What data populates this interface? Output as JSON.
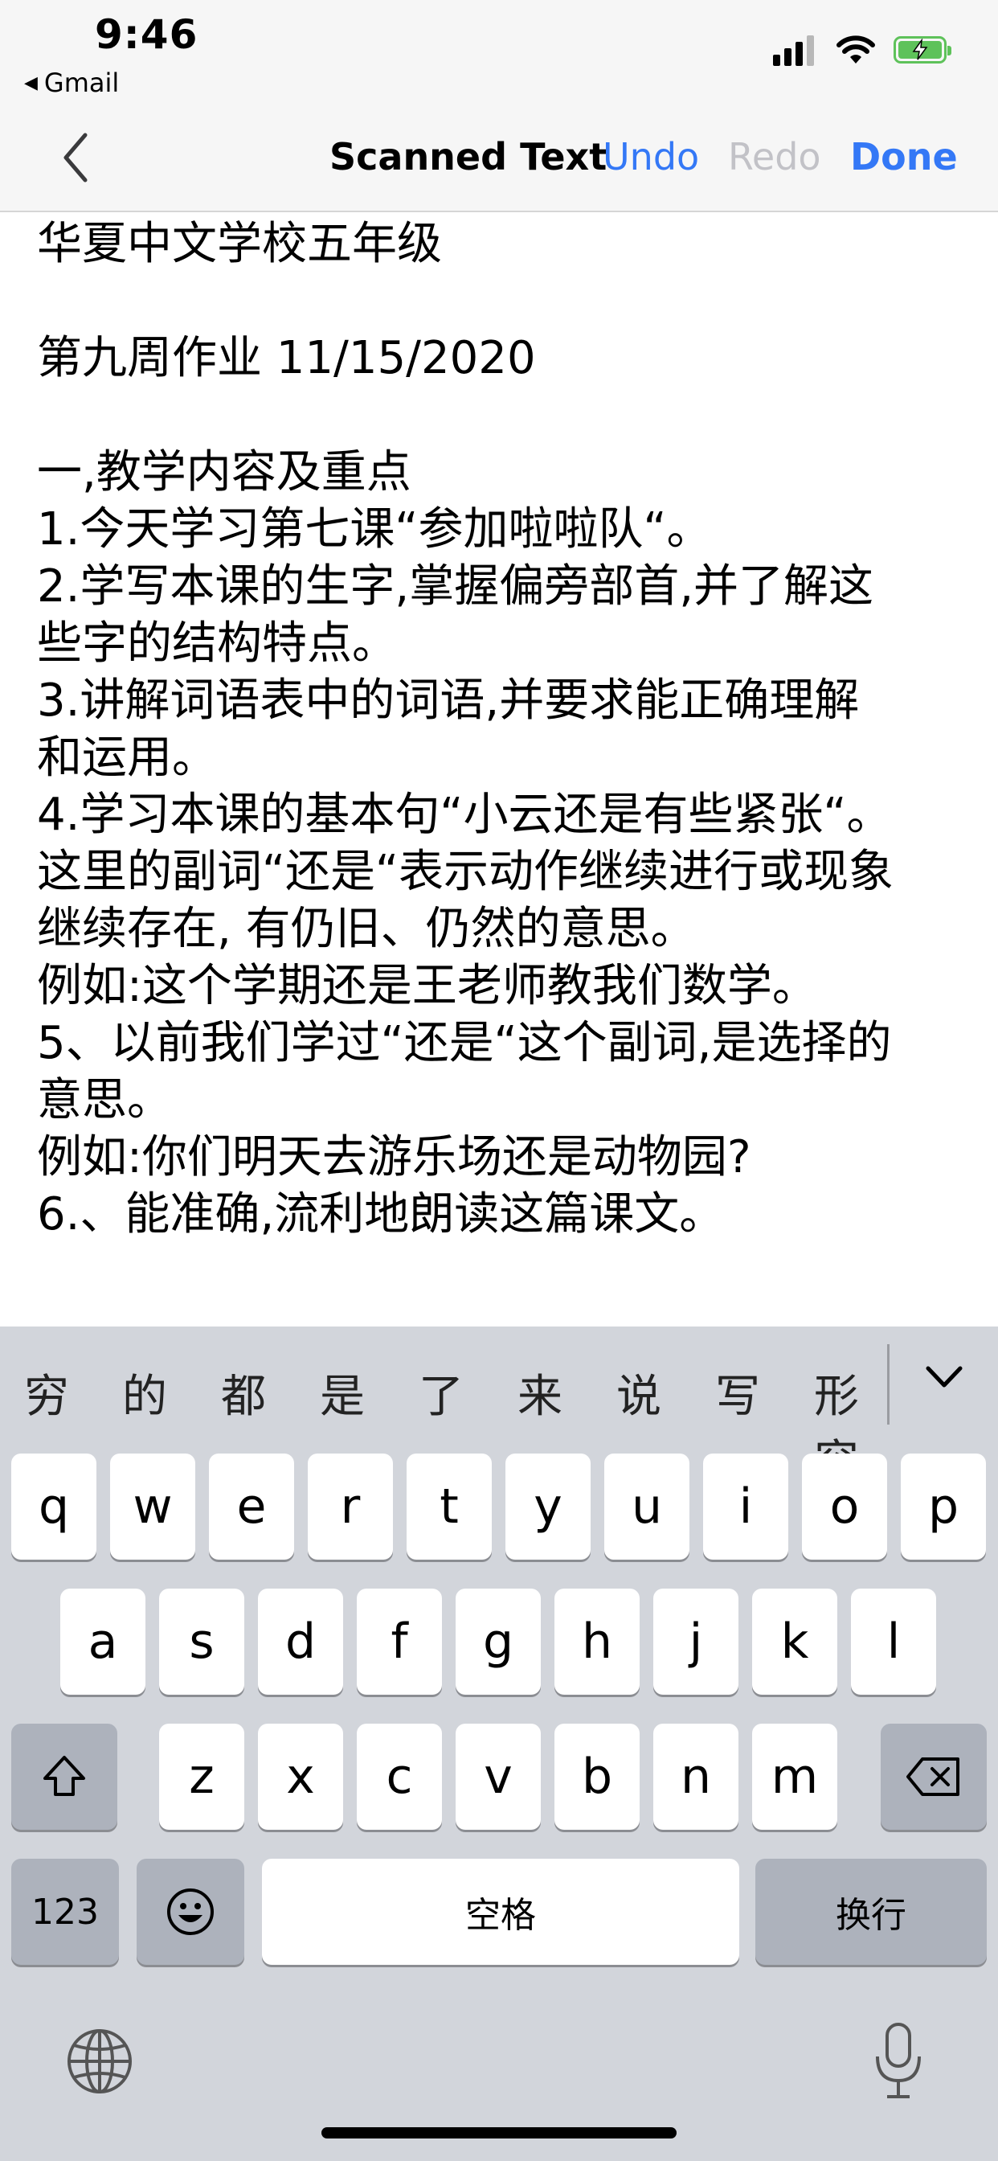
{
  "status_bar": {
    "time": "9:46",
    "back_app": "Gmail",
    "icons": [
      "cellular-signal-icon",
      "wifi-icon",
      "battery-charging-icon"
    ],
    "battery_color": "#5ec25a"
  },
  "nav": {
    "title": "Scanned Text",
    "undo": "Undo",
    "redo": "Redo",
    "done": "Done",
    "accent_color": "#3478f6",
    "disabled_color": "#c2c2c7"
  },
  "content": {
    "lines": [
      "华夏中文学校五年级",
      "",
      "第九周作业 11/15/2020",
      "",
      "一,教学内容及重点",
      "1.今天学习第七课“参加啦啦队“。",
      "2.学写本课的生字,掌握偏旁部首,并了解这",
      "些字的结构特点。",
      "3.讲解词语表中的词语,并要求能正确理解",
      "和运用。",
      "4.学习本课的基本句“小云还是有些紧张“。",
      "这里的副词“还是“表示动作继续进行或现象",
      "继续存在, 有仍旧、仍然的意思。",
      "例如:这个学期还是王老师教我们数学。",
      "5、以前我们学过“还是“这个副词,是选择的",
      "意思。",
      "例如:你们明天去游乐场还是动物园?",
      "6.、能准确,流利地朗读这篇课文。"
    ]
  },
  "keyboard": {
    "candidates": [
      "穷",
      "的",
      "都",
      "是",
      "了",
      "来",
      "说",
      "写",
      "形容"
    ],
    "row1": [
      "q",
      "w",
      "e",
      "r",
      "t",
      "y",
      "u",
      "i",
      "o",
      "p"
    ],
    "row2": [
      "a",
      "s",
      "d",
      "f",
      "g",
      "h",
      "j",
      "k",
      "l"
    ],
    "row3": [
      "z",
      "x",
      "c",
      "v",
      "b",
      "n",
      "m"
    ],
    "numbers_key": "123",
    "space_key": "空格",
    "return_key": "换行",
    "icons": [
      "shift-icon",
      "delete-icon",
      "emoji-icon",
      "globe-icon",
      "microphone-icon",
      "chevron-down-icon"
    ]
  }
}
